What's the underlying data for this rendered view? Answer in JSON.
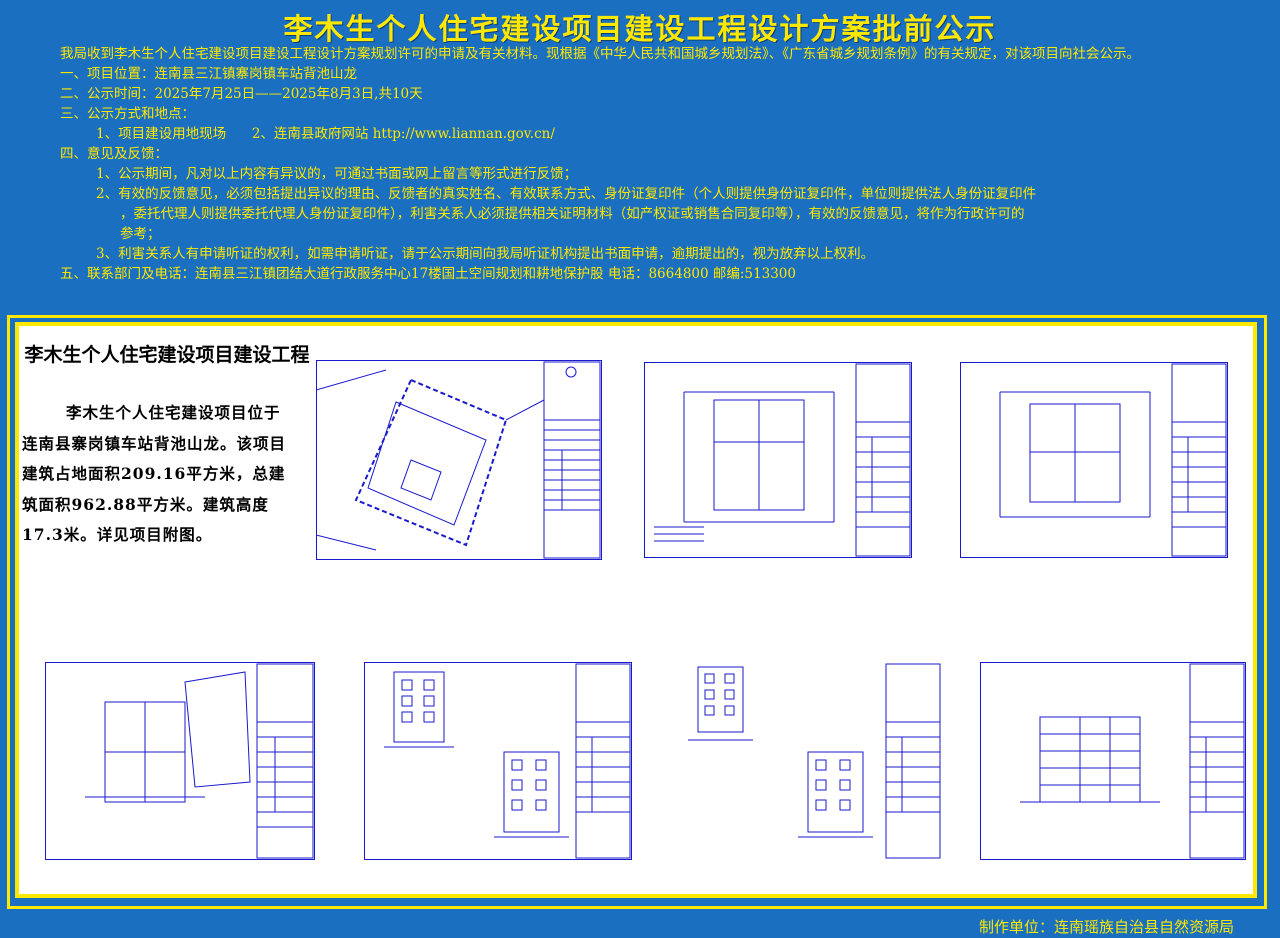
{
  "title": "李木生个人住宅建设项目建设工程设计方案批前公示",
  "notice": {
    "intro": "我局收到李木生个人住宅建设项目建设工程设计方案规划许可的申请及有关材料。现根据《中华人民共和国城乡规划法》、《广东省城乡规划条例》的有关规定，对该项目向社会公示。",
    "item1": "一、项目位置：连南县三江镇寨岗镇车站背池山龙",
    "item2": "二、公示时间：2025年7月25日——2025年8月3日,共10天",
    "item3": "三、公示方式和地点：",
    "item3_detail": "1、项目建设用地现场      2、连南县政府网站 http://www.liannan.gov.cn/",
    "item4": "四、意见及反馈：",
    "item4_1": "1、公示期间，凡对以上内容有异议的，可通过书面或网上留言等形式进行反馈；",
    "item4_2a": "2、有效的反馈意见，必须包括提出异议的理由、反馈者的真实姓名、有效联系方式、身份证复印件（个人则提供身份证复印件，单位则提供法人身份证复印件",
    "item4_2b": "，委托代理人则提供委托代理人身份证复印件），利害关系人必须提供相关证明材料（如产权证或销售合同复印等），有效的反馈意见，将作为行政许可的",
    "item4_2c": "参考；",
    "item4_3": "3、利害关系人有申请听证的权利，如需申请听证，请于公示期间向我局听证机构提出书面申请，逾期提出的，视为放弃以上权利。",
    "item5": "五、联系部门及电话：连南县三江镇团结大道行政服务中心17楼国土空间规划和耕地保护股  电话：8664800 邮编:513300"
  },
  "project": {
    "title": "李木生个人住宅建设项目建设工程",
    "description": "李木生个人住宅建设项目位于连南县寨岗镇车站背池山龙。该项目建筑占地面积209.16平方米，总建筑面积962.88平方米。建筑高度17.3米。详见项目附图。"
  },
  "drawings": [
    {
      "name": "site-plan-drawing",
      "kind": "site"
    },
    {
      "name": "floor-plan-1-drawing",
      "kind": "plan"
    },
    {
      "name": "floor-plan-2-drawing",
      "kind": "plan"
    },
    {
      "name": "floor-plan-3-drawing",
      "kind": "plan"
    },
    {
      "name": "elevation-1-drawing",
      "kind": "elevation"
    },
    {
      "name": "elevation-2-drawing",
      "kind": "elevation"
    },
    {
      "name": "section-drawing",
      "kind": "section"
    }
  ],
  "footer": "制作单位：连南瑶族自治县自然资源局",
  "colors": {
    "background": "#1a6fc0",
    "text": "#ffe800",
    "line": "#1a1acc"
  }
}
